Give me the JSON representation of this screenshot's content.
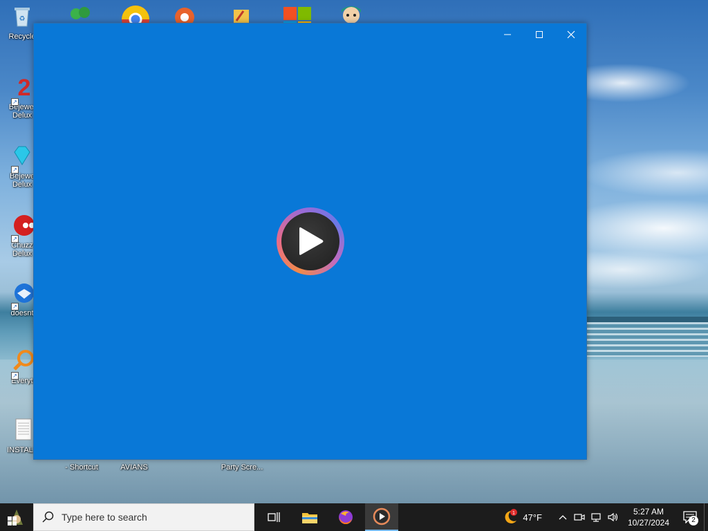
{
  "desktop": {
    "icons_left": [
      {
        "label": "Recycle",
        "icon": "recycle-bin-icon"
      },
      {
        "label": "Bejewel\nDelux",
        "icon": "bejeweled-2-icon"
      },
      {
        "label": "Bejewe\nDelux",
        "icon": "bejeweled-gem-icon"
      },
      {
        "label": "Chuzz\nDelux",
        "icon": "chuzzle-icon"
      },
      {
        "label": "doesnt",
        "icon": "thunderbird-icon"
      },
      {
        "label": "Everyt",
        "icon": "everything-search-icon"
      },
      {
        "label": "INSTALL",
        "icon": "text-file-icon"
      }
    ],
    "icons_bottom": [
      {
        "label": "- Shortcut"
      },
      {
        "label": "AVIANS"
      },
      {
        "label": "Party Scre..."
      }
    ]
  },
  "window": {
    "minimize_icon": "minimize-icon",
    "maximize_icon": "maximize-icon",
    "close_icon": "close-icon",
    "background": "#0978d7",
    "play_icon": "play-icon"
  },
  "taskbar": {
    "search_placeholder": "Type here to search",
    "weather_temp": "47°F",
    "weather_badge": "1",
    "clock_time": "5:27 AM",
    "clock_date": "10/27/2024",
    "notification_count": "2"
  }
}
